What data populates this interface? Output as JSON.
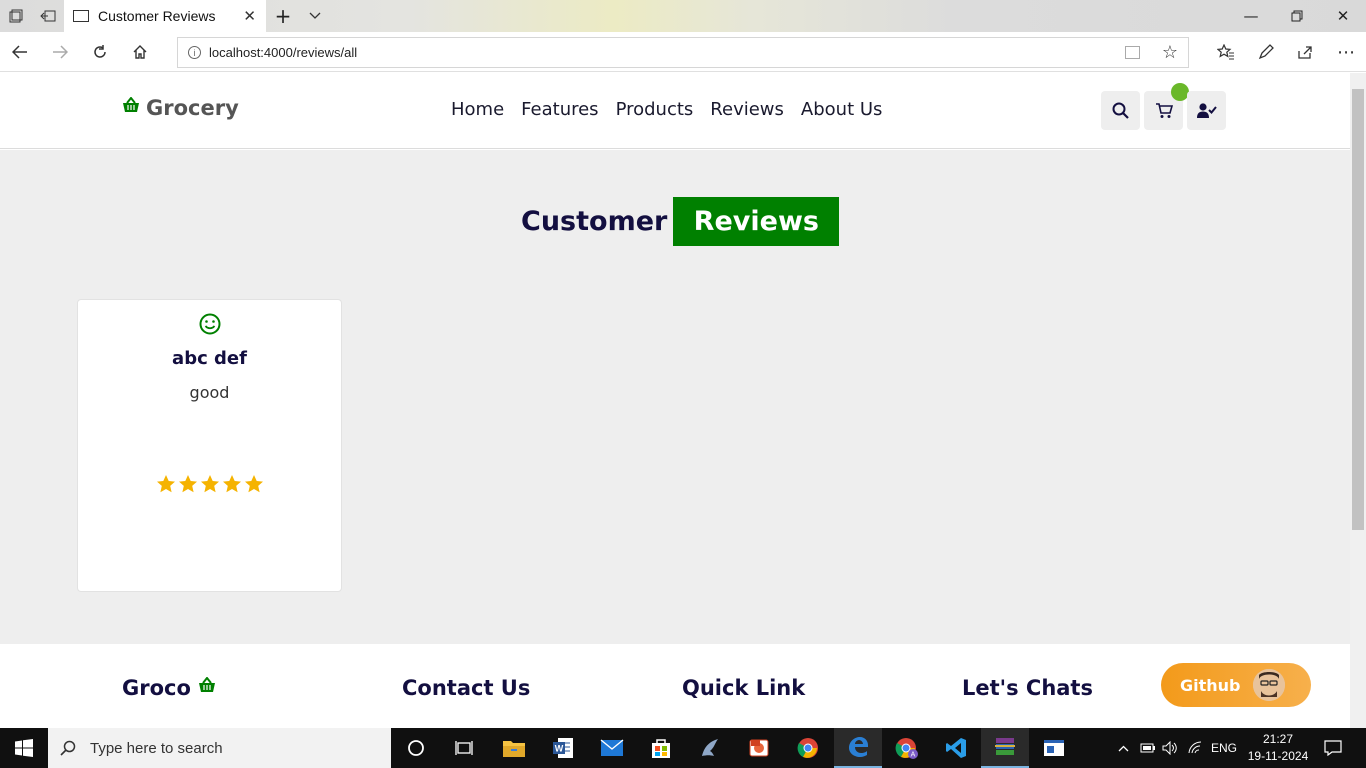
{
  "browser": {
    "tab_title": "Customer Reviews",
    "url": "localhost:4000/reviews/all"
  },
  "site": {
    "logo_text": "Grocery",
    "nav": [
      "Home",
      "Features",
      "Products",
      "Reviews",
      "About Us"
    ]
  },
  "page": {
    "heading_main": "Customer",
    "heading_highlight": "Reviews",
    "accent_color": "#008000"
  },
  "reviews": [
    {
      "name": "abc def",
      "text": "good",
      "rating": 5
    }
  ],
  "footer": {
    "brand": "Groco",
    "headings": [
      "Contact Us",
      "Quick Link",
      "Let's Chats"
    ],
    "github_label": "Github"
  },
  "taskbar": {
    "search_placeholder": "Type here to search",
    "language": "ENG",
    "time": "21:27",
    "date": "19-11-2024"
  }
}
